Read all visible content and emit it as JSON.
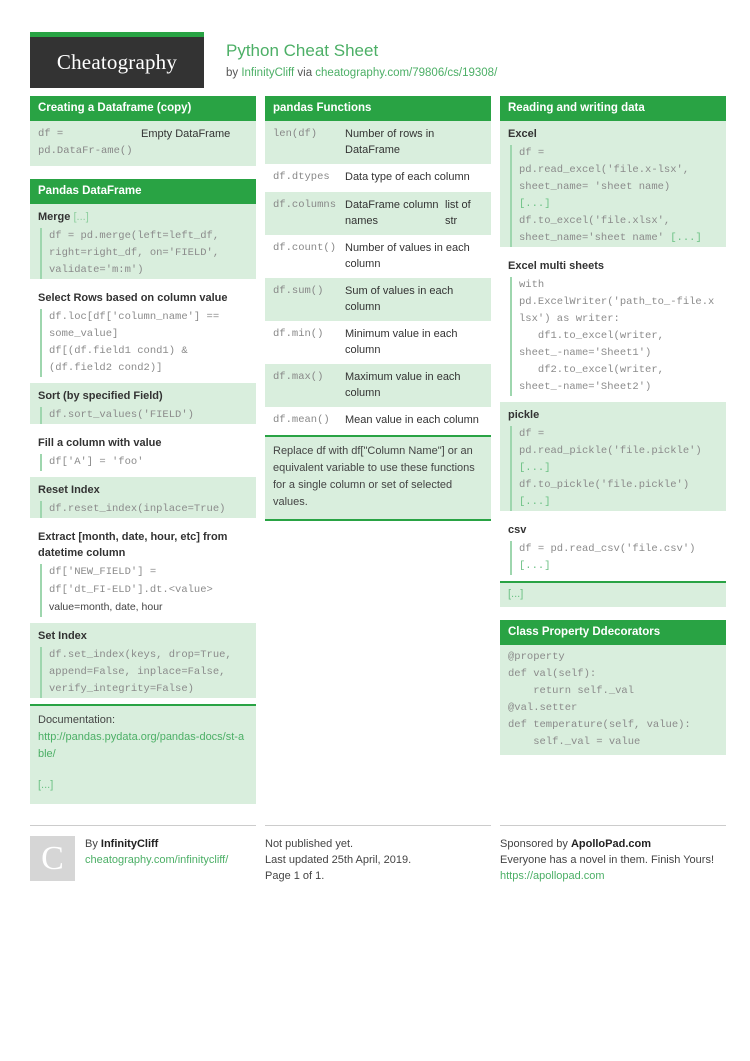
{
  "header": {
    "logo_text": "Cheatography",
    "title": "Python Cheat Sheet",
    "by_prefix": "by ",
    "author": "InfinityCliff",
    "via": " via ",
    "source_url": "cheatography.com/79806/cs/19308/"
  },
  "col1": {
    "creating": {
      "title": "Creating a Dataframe (copy)",
      "rows": [
        {
          "code": "df = pd.DataFr‑ame()",
          "desc": "Empty DataFrame"
        }
      ]
    },
    "pandas_df": {
      "title": "Pandas DataFrame",
      "sections": [
        {
          "heading": "Merge",
          "more": "[...]",
          "code": "df = pd.merge(left=left_df, right=right_df, on='FIELD', validate='m:m')"
        },
        {
          "heading": "Select Rows based on column value",
          "code": "df.loc[df['column_name'] == some_value]\ndf[(df.field1 cond1) & (df.field2 cond2)]"
        },
        {
          "heading": "Sort (by specified Field)",
          "code": "df.sort_values('FIELD')"
        },
        {
          "heading": "Fill a column with value",
          "code": "df['A'] = 'foo'"
        },
        {
          "heading": "Reset Index",
          "code": "df.reset_index(inplace=True)"
        },
        {
          "heading": "Extract [month, date, hour, etc] from datetime column",
          "code": "df['NEW_FIELD'] = df['dt_FI‑ELD'].dt.<value>",
          "code_plain": " value=month, date, hour"
        },
        {
          "heading": "Set Index",
          "code": "df.set_index(keys, drop=True, append=False, inplace=False, verify_integrity=False)"
        }
      ],
      "footer_label": "Documentation:",
      "footer_link": "http://pandas.pydata.org/pandas-docs/st‑able/",
      "footer_more": "[...]"
    }
  },
  "col2": {
    "pandas_functions": {
      "title": "pandas Functions",
      "rows": [
        {
          "fn": "len(df)",
          "desc": "Number of rows in DataFrame",
          "type": ""
        },
        {
          "fn": "df.dtypes",
          "desc": "Data type of each column",
          "type": ""
        },
        {
          "fn": "df.columns",
          "desc": "DataFrame column names",
          "type": "list of str"
        },
        {
          "fn": "df.count()",
          "desc": "Number of values in each column",
          "type": ""
        },
        {
          "fn": "df.sum()",
          "desc": "Sum of values in each column",
          "type": ""
        },
        {
          "fn": "df.min()",
          "desc": "Minimum value in each column",
          "type": ""
        },
        {
          "fn": "df.max()",
          "desc": "Maximum value in each column",
          "type": ""
        },
        {
          "fn": "df.mean()",
          "desc": "Mean value in each column",
          "type": ""
        }
      ],
      "note": "Replace df with df[\"Column Name\"] or an equivalent variable to use these functions for a single column or set of selected values."
    }
  },
  "col3": {
    "reading_writing": {
      "title": "Reading and writing data",
      "sections": [
        {
          "heading": "Excel",
          "code": "df = pd.read_excel('file.x‑lsx', sheet_name= 'sheet name)",
          "more1": "[...]",
          "code2": "df.to_excel('file.xlsx', sheet_name='sheet name'",
          "more2": "[...]"
        },
        {
          "heading": "Excel multi sheets",
          "code": "with pd.ExcelWriter('path_to_‑file.xlsx') as writer:\n   df1.to_excel(writer, sheet_‑name='Sheet1')\n   df2.to_excel(writer, sheet_‑name='Sheet2')"
        },
        {
          "heading": "pickle",
          "code": "df = pd.read_pickle('file.pickle')",
          "more1": "[...]",
          "code2": "df.to_pickle('file.pickle') ",
          "more2": "[...]"
        },
        {
          "heading": "csv",
          "code": "df = pd.read_csv('file.csv')",
          "more1": "[...]"
        }
      ],
      "tail_more": "[...]"
    },
    "decorators": {
      "title": "Class Property Ddecorators",
      "code": "@property\ndef val(self):\n    return self._val\n@val.setter\ndef temperature(self, value):\n    self._val = value"
    }
  },
  "footer": {
    "avatar_letter": "C",
    "by_label": "By ",
    "author": "InfinityCliff",
    "author_url": "cheatography.com/infinitycliff/",
    "publish_status": "Not published yet.",
    "last_updated": "Last updated 25th April, 2019.",
    "page_number": "Page 1 of 1.",
    "sponsor_prefix": "Sponsored by ",
    "sponsor_name": "ApolloPad.com",
    "sponsor_tagline": "Everyone has a novel in them. Finish Yours!",
    "sponsor_url": "https://apollopad.com"
  }
}
